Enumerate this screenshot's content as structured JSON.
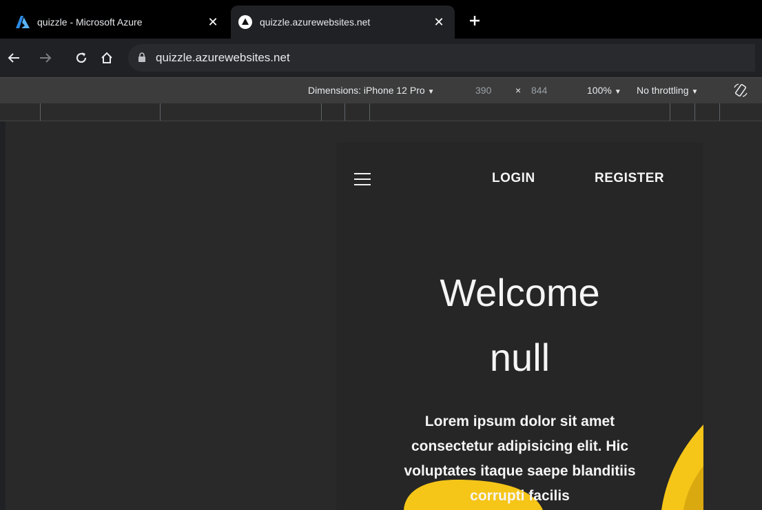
{
  "tabs": [
    {
      "title": "quizzle - Microsoft Azure",
      "icon": "azure-logo-icon",
      "active": false
    },
    {
      "title": "quizzle.azurewebsites.net",
      "icon": "site-favicon-icon",
      "active": true
    }
  ],
  "toolbar": {
    "url": "quizzle.azurewebsites.net",
    "icons": [
      "back-icon",
      "forward-icon",
      "reload-icon",
      "home-icon",
      "lock-icon"
    ]
  },
  "device_toolbar": {
    "dimensions_label": "Dimensions: iPhone 12 Pro",
    "width": "390",
    "times": "×",
    "height": "844",
    "zoom": "100%",
    "throttling": "No throttling"
  },
  "site": {
    "nav": {
      "login": "LOGIN",
      "register": "REGISTER"
    },
    "welcome_line1": "Welcome",
    "welcome_line2": "null",
    "lorem": "Lorem ipsum dolor sit amet consectetur adipisicing elit. Hic voluptates itaque saepe blanditiis corrupti facilis",
    "accent_color": "#f5c518"
  }
}
